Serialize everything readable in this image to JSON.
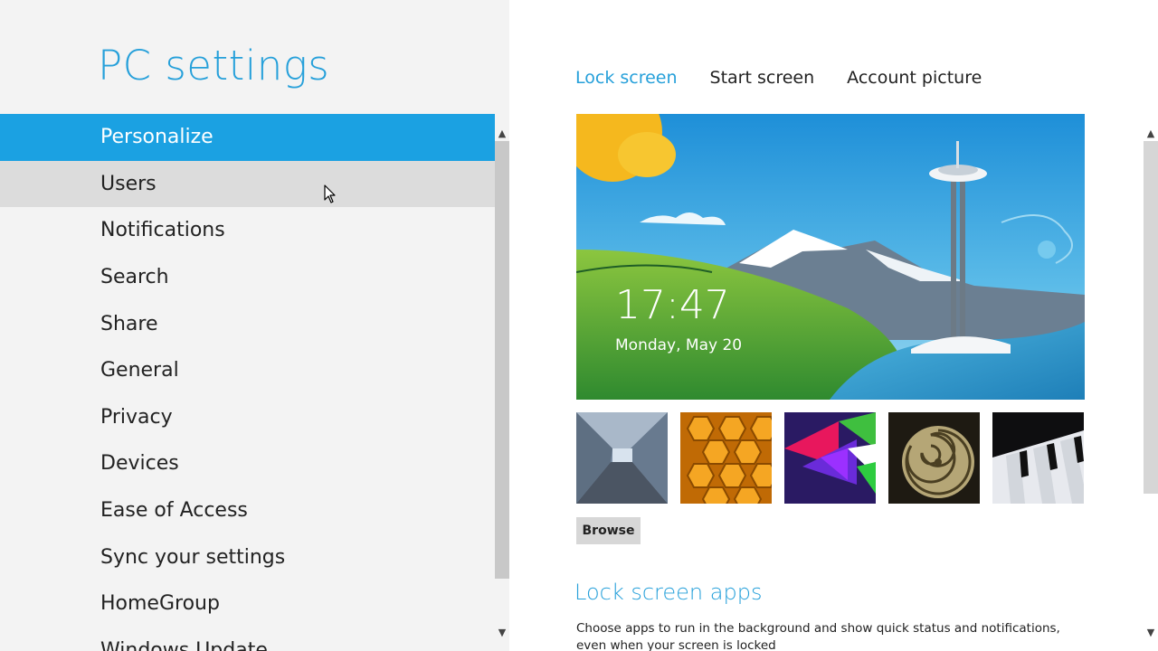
{
  "app": {
    "title": "PC settings"
  },
  "sidebar": {
    "items": [
      {
        "label": "Personalize"
      },
      {
        "label": "Users"
      },
      {
        "label": "Notifications"
      },
      {
        "label": "Search"
      },
      {
        "label": "Share"
      },
      {
        "label": "General"
      },
      {
        "label": "Privacy"
      },
      {
        "label": "Devices"
      },
      {
        "label": "Ease of Access"
      },
      {
        "label": "Sync your settings"
      },
      {
        "label": "HomeGroup"
      },
      {
        "label": "Windows Update"
      }
    ],
    "selected": "Personalize",
    "hovered": "Users"
  },
  "tabs": [
    {
      "label": "Lock screen",
      "active": true
    },
    {
      "label": "Start screen",
      "active": false
    },
    {
      "label": "Account picture",
      "active": false
    }
  ],
  "lock_screen": {
    "time": "17:47",
    "date": "Monday, May 20",
    "thumbnails": [
      "tunnel-image",
      "honeycomb-image",
      "geometric-image",
      "nautilus-shell-image",
      "piano-keys-image"
    ],
    "browse_label": "Browse"
  },
  "lock_screen_apps": {
    "heading": "Lock screen apps",
    "description": "Choose apps to run in the background and show quick status and notifications, even when your screen is locked"
  },
  "colors": {
    "accent": "#1ba1e2",
    "title": "#26a0da",
    "sidebar_bg": "#f3f3f3",
    "hover_bg": "#dcdcdc"
  },
  "icons": {
    "scroll_up": "▲",
    "scroll_down": "▼"
  }
}
